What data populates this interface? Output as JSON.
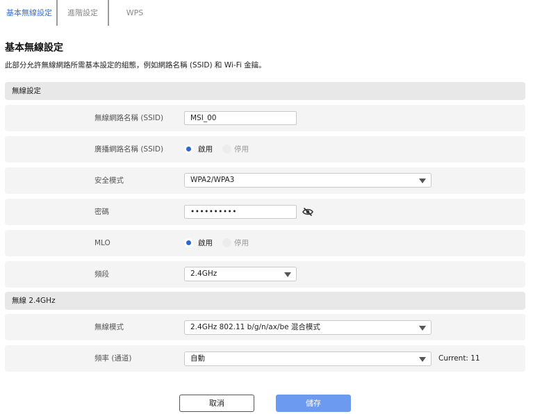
{
  "tabs": [
    {
      "label": "基本無線設定",
      "active": true
    },
    {
      "label": "進階設定",
      "active": false
    },
    {
      "label": "WPS",
      "active": false
    }
  ],
  "page": {
    "title": "基本無線設定",
    "description": "此部分允許無線網路所需基本設定的組態，例如網路名稱 (SSID) 和 Wi-Fi 金鑰。"
  },
  "sections": {
    "wireless": {
      "title": "無線設定"
    },
    "band24": {
      "title": "無線 2.4GHz"
    }
  },
  "fields": {
    "ssid": {
      "label": "無線網路名稱 (SSID)",
      "value": "MSI_00"
    },
    "broadcast": {
      "label": "廣播網路名稱 (SSID)",
      "on_label": "啟用",
      "off_label": "停用",
      "selected": "on"
    },
    "security": {
      "label": "安全模式",
      "value": "WPA2/WPA3"
    },
    "password": {
      "label": "密碼",
      "value": "••••••••••"
    },
    "mlo": {
      "label": "MLO",
      "on_label": "啟用",
      "off_label": "停用",
      "selected": "on"
    },
    "band": {
      "label": "頻段",
      "value": "2.4GHz"
    },
    "wireless_mode": {
      "label": "無線模式",
      "value": "2.4GHz 802.11 b/g/n/ax/be 混合模式"
    },
    "channel": {
      "label": "頻率 (通道)",
      "value": "自動",
      "current": "Current: 11"
    }
  },
  "buttons": {
    "cancel": "取消",
    "save": "儲存"
  },
  "colors": {
    "accent": "#2f63d8",
    "save_button": "#6c9af0",
    "row_bg": "#f4f4f4",
    "section_bg": "#e8e8e8"
  },
  "icons": {
    "password_toggle": "eye-slash-icon",
    "dropdown": "chevron-down-icon"
  }
}
